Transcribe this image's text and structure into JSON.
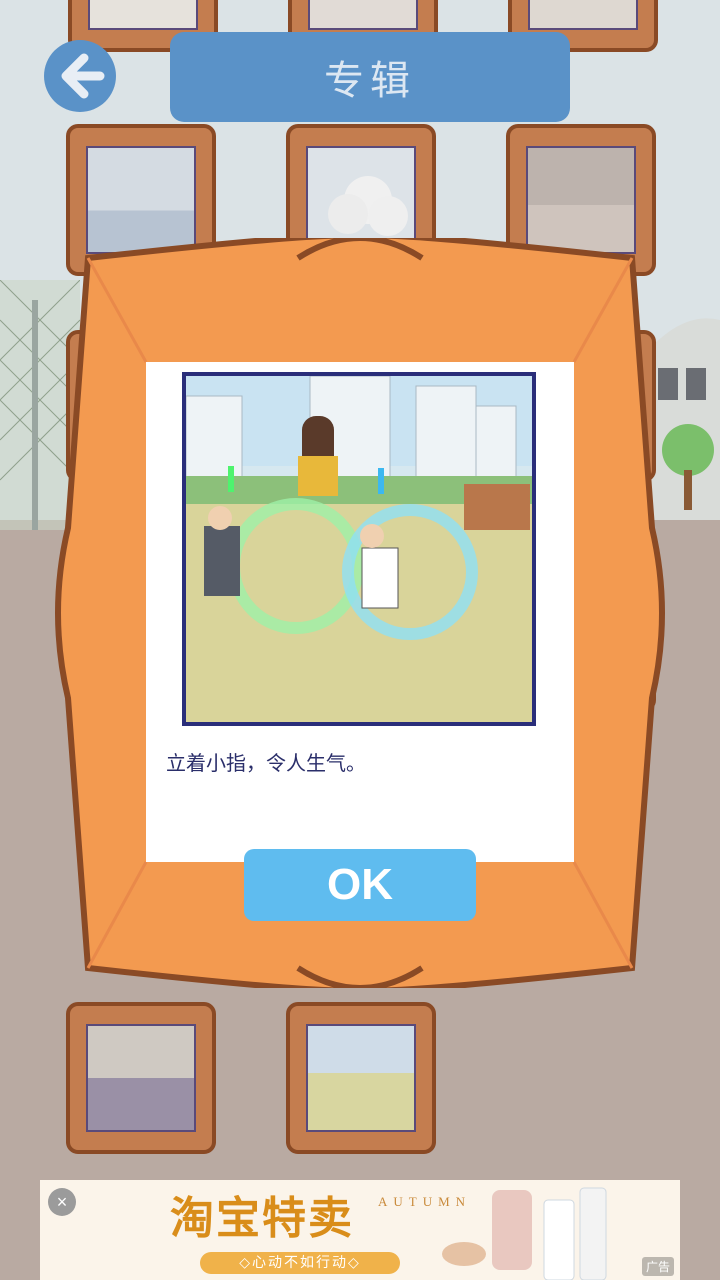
{
  "header": {
    "title": "专辑",
    "back_icon": "arrow-left-icon"
  },
  "album": {
    "thumbnails": [
      {
        "name": "thumb-1",
        "scene": "bathroom-fight"
      },
      {
        "name": "thumb-2",
        "scene": "smoke-cloud"
      },
      {
        "name": "thumb-3",
        "scene": "flower-gift"
      },
      {
        "name": "thumb-4",
        "scene": "graffiti-wall"
      },
      {
        "name": "thumb-5",
        "scene": "glowstick-dance"
      }
    ]
  },
  "dialog": {
    "caption": "立着小指，令人生气。",
    "ok_label": "OK"
  },
  "ad": {
    "headline": "淘宝特卖",
    "subline": "AUTUMN",
    "slogan": "◇心动不如行动◇",
    "tag": "广告",
    "close_icon": "close-icon"
  },
  "colors": {
    "header_blue": "#5a92c8",
    "frame_orange": "#f39a50",
    "frame_border": "#8a4a25",
    "ok_blue": "#5fbcef",
    "caption_text": "#2a2e6a"
  }
}
